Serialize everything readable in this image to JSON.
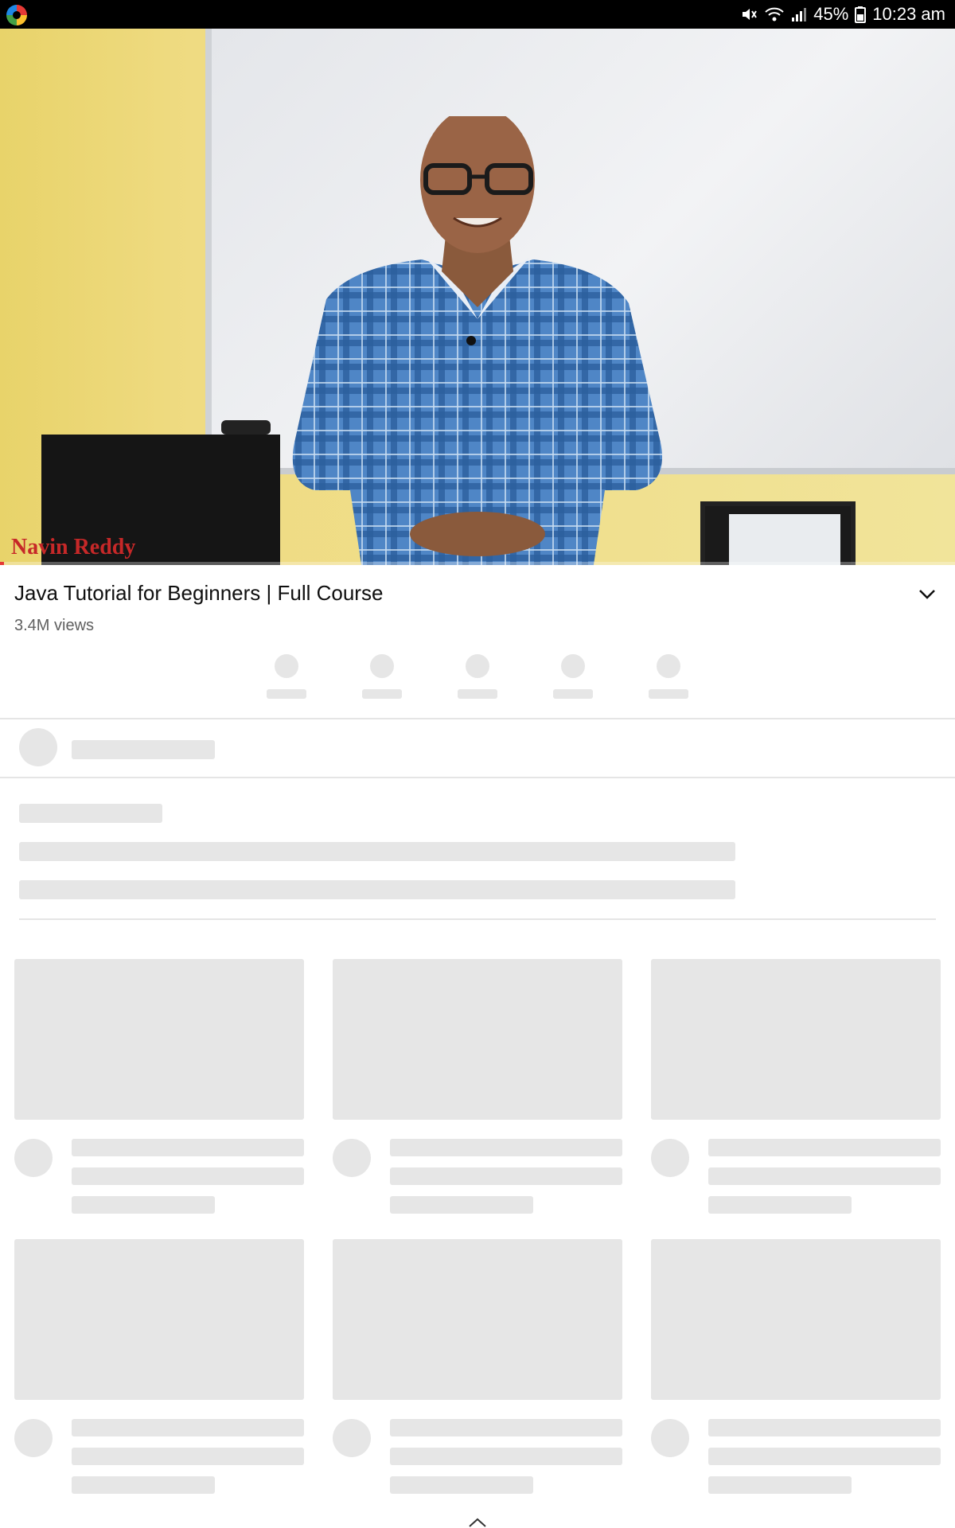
{
  "status_bar": {
    "battery": "45%",
    "time": "10:23 am",
    "icons": [
      "app-launcher-icon",
      "mute-icon",
      "wifi-icon",
      "signal-icon",
      "battery-icon"
    ]
  },
  "video": {
    "watermark": "Navin Reddy",
    "progress": 0.004
  },
  "video_info": {
    "title": "Java Tutorial for Beginners | Full Course",
    "views": "3.4M views",
    "expand_icon": "chevron-down-icon"
  },
  "loading_placeholders": {
    "action_buttons": 5,
    "recommended_cards": 6
  },
  "colors": {
    "placeholder": "#e6e6e6",
    "progress_played": "#e53935",
    "watermark": "#c62828"
  }
}
